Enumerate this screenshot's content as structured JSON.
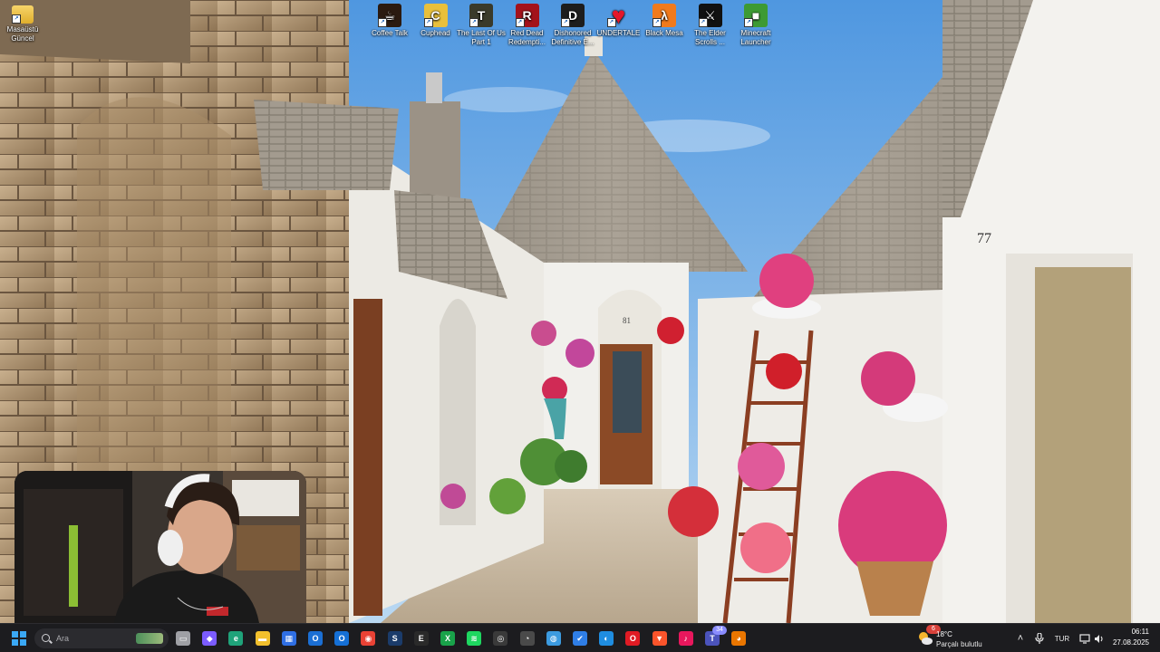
{
  "desktop": {
    "left_icon": {
      "name": "Masaüstü Güncel",
      "icon": "folder-icon"
    },
    "top_icons": [
      {
        "name": "Coffee Talk",
        "icon": "coffee-talk-icon",
        "color": "#2b1a10",
        "glyph": "☕"
      },
      {
        "name": "Cuphead",
        "icon": "cuphead-icon",
        "color": "#e9c03b",
        "glyph": "C"
      },
      {
        "name": "The Last Of Us Part 1",
        "icon": "tlou-icon",
        "color": "#3a3a2a",
        "glyph": "T"
      },
      {
        "name": "Red Dead Redempti...",
        "icon": "rdr-icon",
        "color": "#a3121b",
        "glyph": "R"
      },
      {
        "name": "Dishonored Definitive E...",
        "icon": "dishonored-icon",
        "color": "#1d1d1d",
        "glyph": "D"
      },
      {
        "name": "UNDERTALE",
        "icon": "heart-icon",
        "color": "#e3162a",
        "glyph": "♥"
      },
      {
        "name": "Black Mesa",
        "icon": "black-mesa-icon",
        "color": "#f07a1c",
        "glyph": "λ"
      },
      {
        "name": "The Elder Scrolls ...",
        "icon": "elder-scrolls-icon",
        "color": "#111111",
        "glyph": "⚔"
      },
      {
        "name": "Minecraft Launcher",
        "icon": "minecraft-icon",
        "color": "#3d9a34",
        "glyph": "■"
      }
    ],
    "wallpaper_labels": {
      "house_number_right": "77",
      "door_number": "81"
    }
  },
  "taskbar": {
    "search": {
      "placeholder": "Ara"
    },
    "apps": [
      {
        "name": "windows-start",
        "color": "#2aa0f0",
        "glyph": ""
      },
      {
        "name": "task-view",
        "color": "#9fa0a5",
        "glyph": "▭"
      },
      {
        "name": "copilot",
        "color": "#7b5cff",
        "glyph": "◆"
      },
      {
        "name": "edge",
        "color": "#1fa37a",
        "glyph": "e"
      },
      {
        "name": "file-explorer",
        "color": "#f2c02d",
        "glyph": "▬"
      },
      {
        "name": "microsoft-store",
        "color": "#2f6fe4",
        "glyph": "▦"
      },
      {
        "name": "outlook",
        "color": "#1b6fd4",
        "glyph": "O"
      },
      {
        "name": "outlook-new",
        "color": "#1570d6",
        "glyph": "O"
      },
      {
        "name": "chrome",
        "color": "#e94235",
        "glyph": "◉"
      },
      {
        "name": "steam",
        "color": "#1b3c6b",
        "glyph": "S"
      },
      {
        "name": "epic-games",
        "color": "#2a2a2a",
        "glyph": "E"
      },
      {
        "name": "xbox",
        "color": "#19a34a",
        "glyph": "X"
      },
      {
        "name": "spotify",
        "color": "#1ed760",
        "glyph": "≋"
      },
      {
        "name": "obs",
        "color": "#3a3a3a",
        "glyph": "◎"
      },
      {
        "name": "timer",
        "color": "#4a4a4a",
        "glyph": "◔"
      },
      {
        "name": "earth-app",
        "color": "#3c9be0",
        "glyph": "◍"
      },
      {
        "name": "todo",
        "color": "#2f7ee6",
        "glyph": "✔"
      },
      {
        "name": "battle-net",
        "color": "#1f8de0",
        "glyph": "◐"
      },
      {
        "name": "opera",
        "color": "#e01b24",
        "glyph": "O"
      },
      {
        "name": "brave",
        "color": "#fb542b",
        "glyph": "▼"
      },
      {
        "name": "tiktok",
        "color": "#e8175d",
        "glyph": "♪"
      },
      {
        "name": "teams",
        "color": "#4b53bc",
        "glyph": "T"
      },
      {
        "name": "blender",
        "color": "#ea7600",
        "glyph": "◕"
      }
    ],
    "teams_badge": "34",
    "weather": {
      "temp": "18°C",
      "condition": "Parçalı bulutlu",
      "badge": "6"
    },
    "tray": {
      "chevron": "˄",
      "mic": "🎙",
      "language": "TUR"
    },
    "clock": {
      "time": "06:11",
      "date": "27.08.2025"
    }
  }
}
